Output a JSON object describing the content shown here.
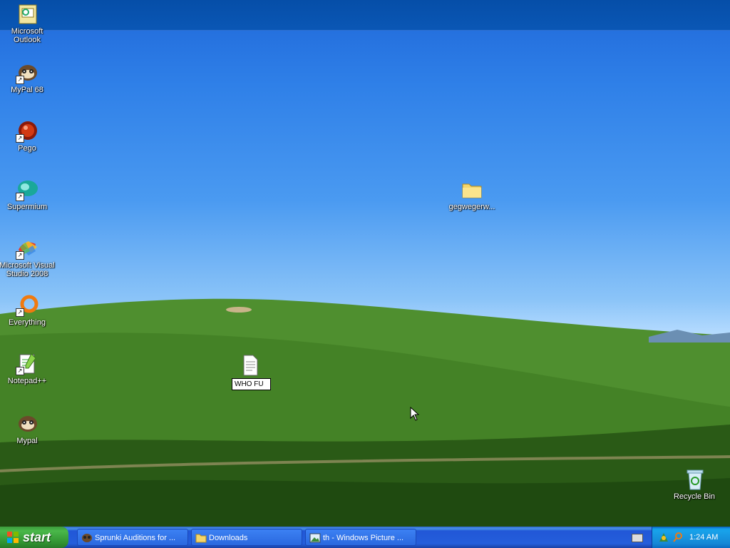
{
  "desktop": {
    "icons": [
      {
        "label": "Microsoft Outlook",
        "icon": "outlook-icon"
      },
      {
        "label": "MyPal 68",
        "icon": "mypal-icon"
      },
      {
        "label": "Pego",
        "icon": "pego-icon"
      },
      {
        "label": "Supermium",
        "icon": "supermium-icon"
      },
      {
        "label": "Microsoft Visual Studio 2008",
        "icon": "visual-studio-icon"
      },
      {
        "label": "Everything",
        "icon": "everything-icon"
      },
      {
        "label": "Notepad++",
        "icon": "notepadpp-icon"
      },
      {
        "label": "Mypal",
        "icon": "mypal-icon"
      }
    ],
    "folder": {
      "label": "gegwegerw...",
      "icon": "folder-icon"
    },
    "renaming_file": {
      "value": "WHO FU",
      "icon": "text-document-icon"
    },
    "recycle_bin": {
      "label": "Recycle Bin",
      "icon": "recycle-bin-icon"
    }
  },
  "taskbar": {
    "start_label": "start",
    "buttons": [
      {
        "label": "Sprunki Auditions for ...",
        "icon": "mypal-icon"
      },
      {
        "label": "Downloads",
        "icon": "folder-icon"
      },
      {
        "label": "th - Windows Picture ...",
        "icon": "picture-viewer-icon"
      }
    ],
    "tray": {
      "clock": "1:24 AM",
      "icons": [
        "network-icon",
        "search-icon"
      ]
    }
  },
  "colors": {
    "taskbar_blue": "#245edb",
    "start_green": "#3c9a3c",
    "tray_blue": "#139ee9"
  }
}
